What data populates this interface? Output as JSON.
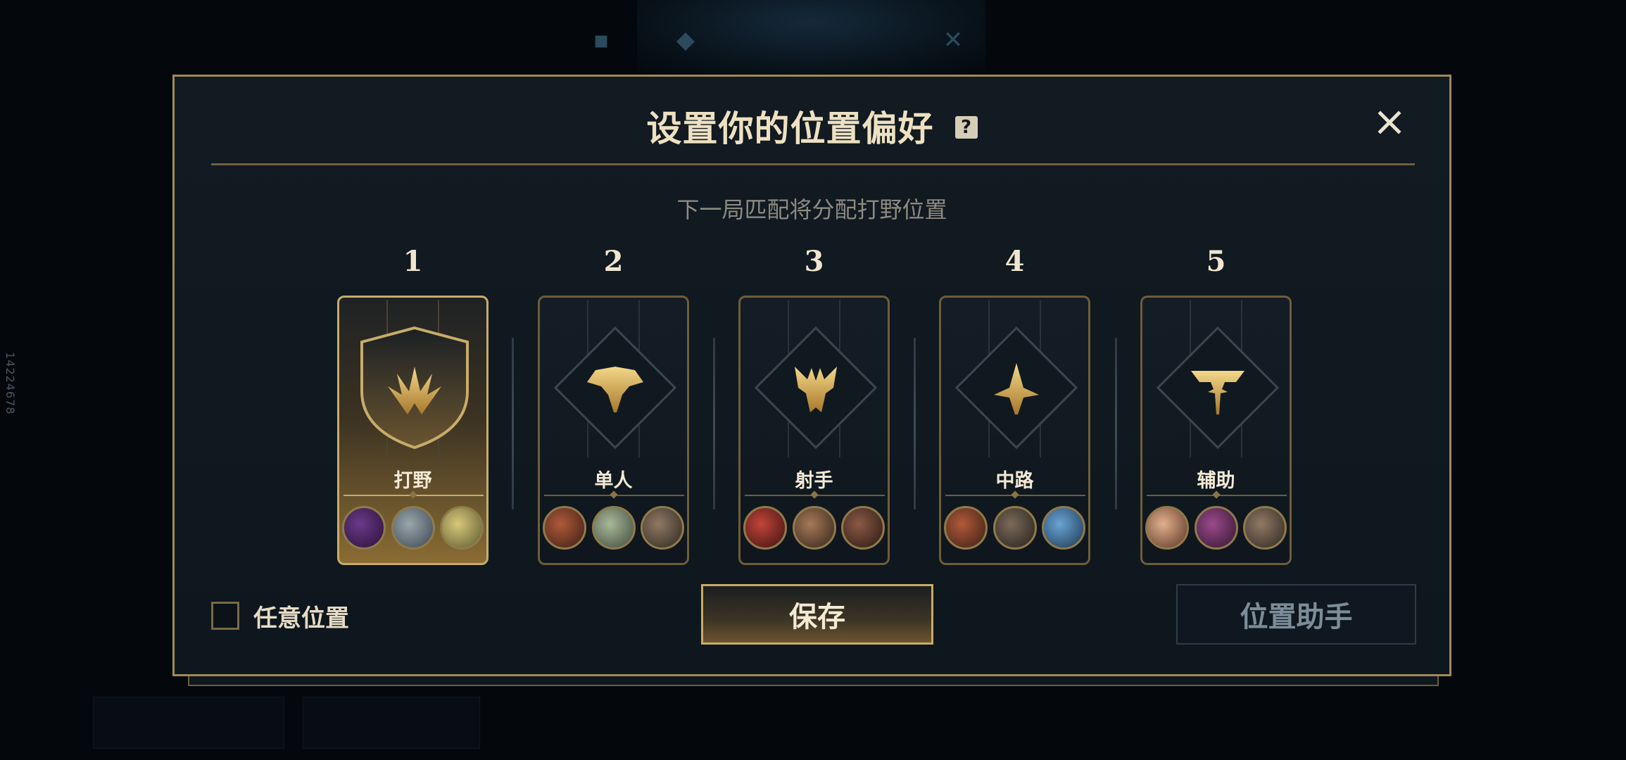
{
  "background": {
    "side_text": "14224678"
  },
  "modal": {
    "title": "设置你的位置偏好",
    "help_icon_label": "?",
    "close_icon": "close-icon",
    "subtitle": "下一局匹配将分配打野位置"
  },
  "positions": [
    {
      "rank": "1",
      "role": "打野",
      "selected": true,
      "icon": "jungle-icon",
      "champions": [
        "champion-1-1",
        "champion-1-2",
        "champion-1-3"
      ]
    },
    {
      "rank": "2",
      "role": "单人",
      "selected": false,
      "icon": "top-lane-icon",
      "champions": [
        "champion-2-1",
        "champion-2-2",
        "champion-2-3"
      ]
    },
    {
      "rank": "3",
      "role": "射手",
      "selected": false,
      "icon": "bot-lane-icon",
      "champions": [
        "champion-3-1",
        "champion-3-2",
        "champion-3-3"
      ]
    },
    {
      "rank": "4",
      "role": "中路",
      "selected": false,
      "icon": "mid-lane-icon",
      "champions": [
        "champion-4-1",
        "champion-4-2",
        "champion-4-3"
      ]
    },
    {
      "rank": "5",
      "role": "辅助",
      "selected": false,
      "icon": "support-icon",
      "champions": [
        "champion-5-1",
        "champion-5-2",
        "champion-5-3"
      ]
    }
  ],
  "footer": {
    "any_position_label": "任意位置",
    "any_position_checked": false,
    "save_label": "保存",
    "assistant_label": "位置助手"
  },
  "colors": {
    "gold": "#c7ac6a",
    "gold_dark": "#6e5d38",
    "panel": "#121a22",
    "text_light": "#eee1c1"
  }
}
